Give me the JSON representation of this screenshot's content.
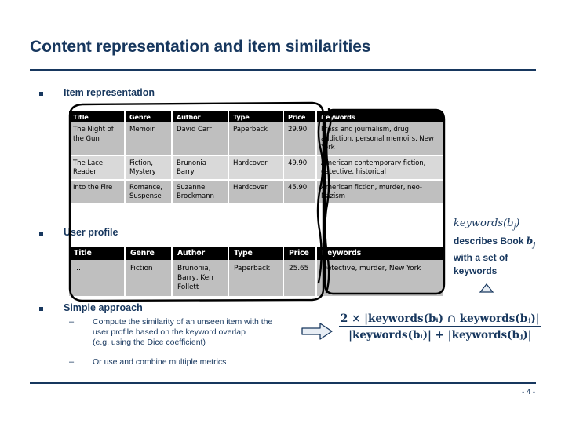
{
  "slide": {
    "title": "Content representation and item similarities",
    "page_number": "- 4 -",
    "accent_color": "#17375e",
    "header_bg_color": "#000000",
    "row_dark_color": "#bfbfbf",
    "row_light_color": "#d9d9d9"
  },
  "sections": {
    "item_representation": {
      "label": "Item representation"
    },
    "user_profile": {
      "label": "User profile"
    },
    "simple_approach": {
      "label": "Simple approach",
      "points": [
        {
          "dash": "–",
          "lines": [
            "Compute the similarity of an unseen item with the",
            "user profile based on the keyword overlap",
            "(e.g. using the Dice coefficient)"
          ]
        },
        {
          "dash": "–",
          "lines": [
            "Or use and combine multiple metrics"
          ]
        }
      ]
    }
  },
  "item_table": {
    "columns": [
      "Title",
      "Genre",
      "Author",
      "Type",
      "Price",
      "Keywords"
    ],
    "rows": [
      {
        "title": "The Night of the Gun",
        "genre": "Memoir",
        "author": "David Carr",
        "type": "Paperback",
        "price": "29.90",
        "keywords": "Press and journalism, drug addiction, personal memoirs, New York"
      },
      {
        "title": "The Lace Reader",
        "genre": "Fiction, Mystery",
        "author": "Brunonia Barry",
        "type": "Hardcover",
        "price": "49.90",
        "keywords": "American contemporary fiction, detective, historical"
      },
      {
        "title": "Into the Fire",
        "genre": "Romance, Suspense",
        "author": "Suzanne Brockmann",
        "type": "Hardcover",
        "price": "45.90",
        "keywords": "American fiction, murder, neo-Nazism"
      }
    ]
  },
  "profile_table": {
    "columns": [
      "Title",
      "Genre",
      "Author",
      "Type",
      "Price",
      "Keywords"
    ],
    "rows": [
      {
        "title": "…",
        "genre": "Fiction",
        "author": "Brunonia, Barry, Ken Follett",
        "type": "Paperback",
        "price": "25.65",
        "keywords": "Detective, murder, New York"
      }
    ]
  },
  "annotation_note": {
    "line1_prefix": "keywords(b",
    "line1_sub": "j",
    "line1_suffix": ")",
    "line2": "describes Book",
    "line2_var": "b",
    "line2_var_sub": "j",
    "line3": "with a set of",
    "line4": "keywords"
  },
  "formula": {
    "numerator": "2 × |keywords(bᵢ) ∩ keywords(bⱼ)|",
    "denominator": "|keywords(bᵢ)| + |keywords(bⱼ)|",
    "arrow": "right-arrow"
  }
}
